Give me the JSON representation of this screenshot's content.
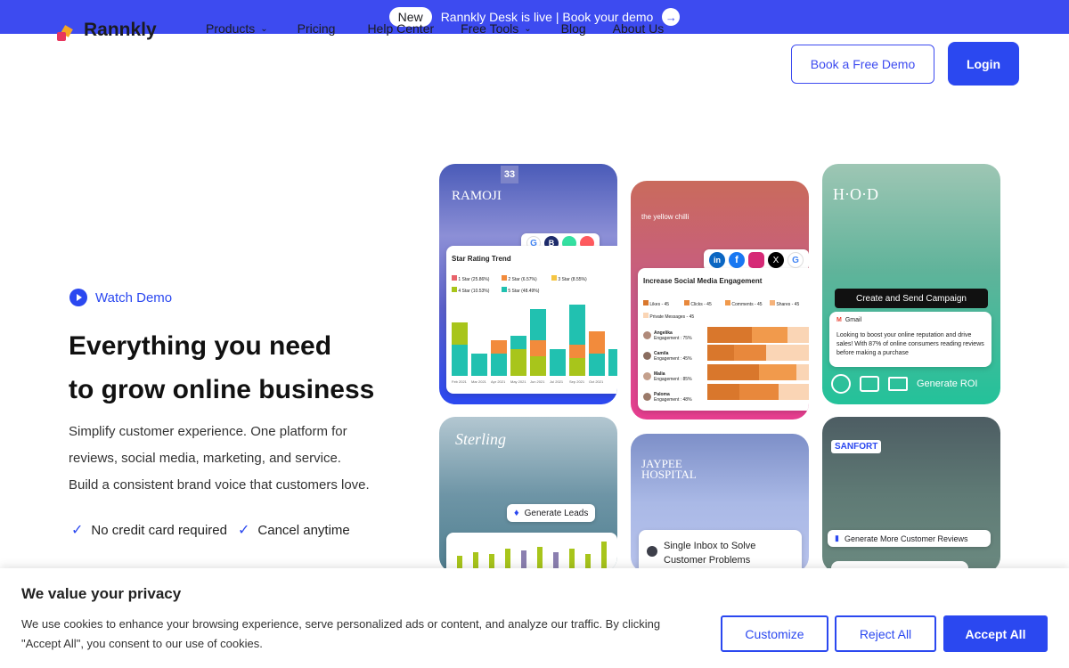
{
  "announcement": {
    "badge": "New",
    "text": "Rannkly Desk is live | Book your demo",
    "arrow": "→"
  },
  "nav": {
    "logo": "Rannkly",
    "items": [
      {
        "label": "Products",
        "dropdown": true
      },
      {
        "label": "Pricing",
        "dropdown": false
      },
      {
        "label": "Help Center",
        "dropdown": false
      },
      {
        "label": "Free Tools",
        "dropdown": true
      },
      {
        "label": "Blog",
        "dropdown": false
      },
      {
        "label": "About Us",
        "dropdown": false
      }
    ],
    "demo_button": "Book a Free Demo",
    "login_button": "Login"
  },
  "hero": {
    "watch_demo": "Watch Demo",
    "headline_line1": "Everything you need",
    "headline_line2": "to grow online business",
    "sub_line1": "Simplify customer experience. One platform for",
    "sub_line2": "reviews, social media, marketing, and service.",
    "sub_line3": "Build a consistent brand voice that customers love.",
    "check1": "No credit card required",
    "check2": "Cancel anytime"
  },
  "cards": {
    "ramoji": {
      "brand": "RAMOJI",
      "badge": "33",
      "panel_title": "Star Rating Trend",
      "legend": [
        "1 Star (25.86%)",
        "2 Star (6.57%)",
        "3 Star (8.55%)",
        "4 Star (10.53%)",
        "5 Star (48.49%)"
      ],
      "months": [
        "Feb 2021",
        "Mar 2021",
        "Apr 2021",
        "May 2021",
        "Jun 2021",
        "Jul 2021",
        "Sep 2021",
        "Oct 2021"
      ]
    },
    "yellow_chilli": {
      "brand": "the yellow chilli",
      "panel_title": "Increase Social Media Engagement",
      "stats": [
        "Likes - 45",
        "Clicks - 45",
        "Comments - 45",
        "Shares - 45",
        "Private Messages - 45"
      ],
      "people": [
        {
          "name": "Angelika",
          "eng": "Engagement : 75%"
        },
        {
          "name": "Camila",
          "eng": "Engagement : 45%"
        },
        {
          "name": "Malia",
          "eng": "Engagement : 85%"
        },
        {
          "name": "Paloma",
          "eng": "Engagement : 48%"
        }
      ]
    },
    "hod": {
      "brand": "H·O·D",
      "campaign": "Create and Send Campaign",
      "mail": "Gmail",
      "message": "Looking to boost your online reputation and drive sales! With 87% of online consumers reading reviews before making a purchase",
      "roi": "Generate ROI"
    },
    "sterling": {
      "brand": "Sterling",
      "chip": "Generate Leads"
    },
    "jaypee": {
      "brand": "JAYPEE HOSPITAL",
      "chip_line1": "Single Inbox to Solve",
      "chip_line2": "Customer Problems"
    },
    "sanfort": {
      "brand": "SANFORT",
      "chip": "Generate More Customer Reviews"
    }
  },
  "cookie": {
    "title": "We value your privacy",
    "text": "We use cookies to enhance your browsing experience, serve personalized ads or content, and analyze our traffic. By clicking \"Accept All\", you consent to our use of cookies.",
    "customize": "Customize",
    "reject": "Reject All",
    "accept": "Accept All"
  },
  "colors": {
    "brand": "#2b48f0",
    "topbar": "#3d4bf0"
  }
}
